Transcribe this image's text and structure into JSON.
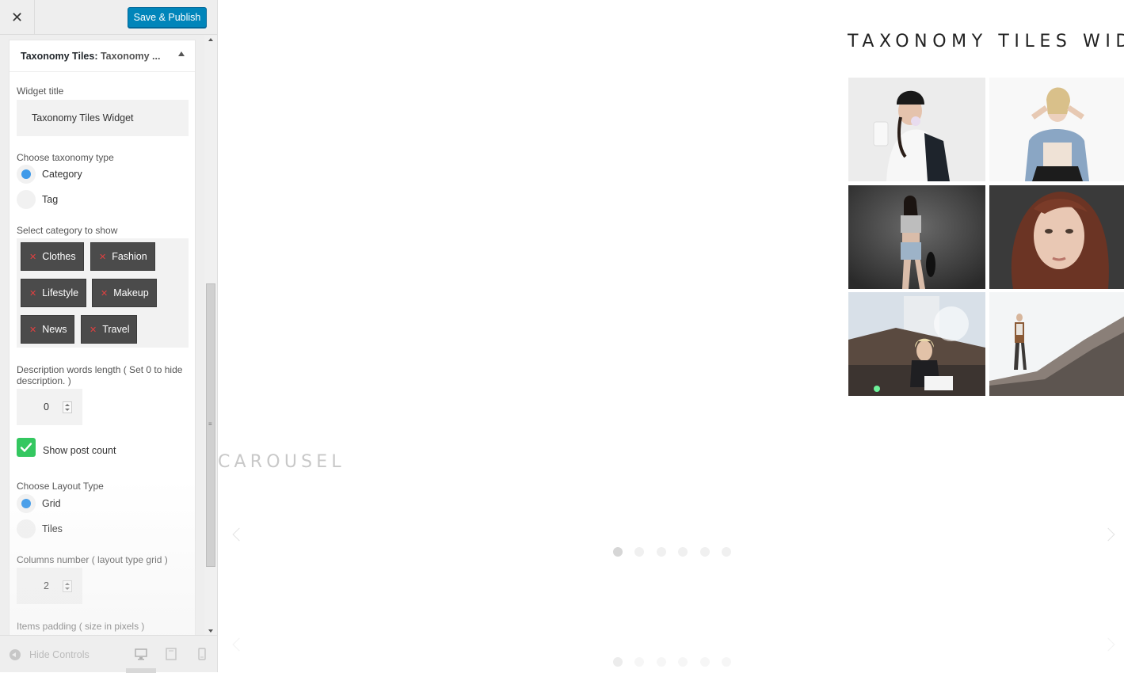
{
  "topbar": {
    "close_glyph": "✕",
    "save_label": "Save & Publish"
  },
  "widget": {
    "header_title": "Taxonomy Tiles:",
    "header_subtitle": "Taxonomy ...",
    "widget_title_label": "Widget title",
    "widget_title_value": "Taxonomy Tiles Widget",
    "taxonomy_label": "Choose taxonomy type",
    "taxonomy_options": [
      {
        "label": "Category",
        "selected": true
      },
      {
        "label": "Tag",
        "selected": false
      }
    ],
    "category_label": "Select category to show",
    "categories": [
      "Clothes",
      "Fashion",
      "Lifestyle",
      "Makeup",
      "News",
      "Travel"
    ],
    "desc_length_label_1": "Description words length ( Set 0 to hide",
    "desc_length_label_2": "description. )",
    "desc_length_value": "0",
    "show_post_count_label": "Show post count",
    "show_post_count_checked": true,
    "layout_label": "Choose Layout Type",
    "layout_options": [
      {
        "label": "Grid",
        "selected": true
      },
      {
        "label": "Tiles",
        "selected": false
      }
    ],
    "columns_label": "Columns number ( layout type grid )",
    "columns_value": "2",
    "padding_label": "Items padding ( size in pixels )"
  },
  "footer": {
    "hide_controls_label": "Hide Controls"
  },
  "preview": {
    "taxonomy_title": "TAXONOMY TILES WIDGET",
    "carousel_title": "CAROUSEL",
    "carousel_dots": 6,
    "active_dot": 0
  },
  "colors": {
    "accent_blue": "#0085ba",
    "radio_blue": "#3f9ae9",
    "check_green": "#34c760",
    "tag_dark": "#4b4b4b"
  }
}
